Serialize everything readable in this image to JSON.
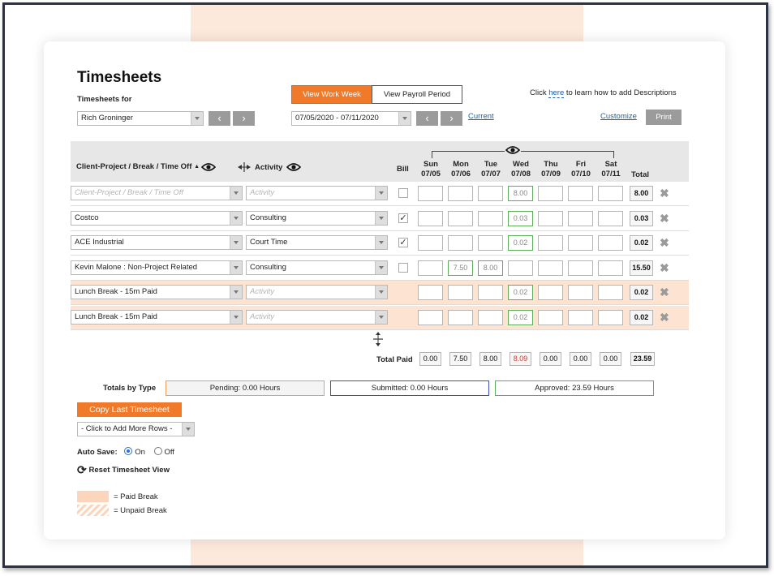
{
  "page_title": "Timesheets",
  "timesheets_for_label": "Timesheets for",
  "employee_select": "Rich Groninger",
  "view_toggle": {
    "work_week": "View Work Week",
    "payroll_period": "View Payroll Period"
  },
  "date_range": "07/05/2020 - 07/11/2020",
  "current_link": "Current",
  "help_text": {
    "prefix": "Click ",
    "link": "here",
    "suffix": " to learn how to add Descriptions"
  },
  "customize_link": "Customize",
  "print_button": "Print",
  "columns": {
    "client_project": "Client-Project / Break / Time Off",
    "activity": "Activity",
    "bill": "Bill",
    "days": [
      {
        "name": "Sun",
        "date": "07/05"
      },
      {
        "name": "Mon",
        "date": "07/06"
      },
      {
        "name": "Tue",
        "date": "07/07"
      },
      {
        "name": "Wed",
        "date": "07/08"
      },
      {
        "name": "Thu",
        "date": "07/09"
      },
      {
        "name": "Fri",
        "date": "07/10"
      },
      {
        "name": "Sat",
        "date": "07/11"
      }
    ],
    "total": "Total"
  },
  "rows": [
    {
      "project": "Client-Project / Break / Time Off",
      "project_placeholder": true,
      "activity": "Activity",
      "activity_placeholder": true,
      "bill": "unchecked",
      "values": [
        "",
        "",
        "",
        "8.00",
        "",
        "",
        ""
      ],
      "total": "8.00",
      "paid_break": false
    },
    {
      "project": "Costco",
      "project_placeholder": false,
      "activity": "Consulting",
      "activity_placeholder": false,
      "bill": "checked",
      "values": [
        "",
        "",
        "",
        "0.03",
        "",
        "",
        ""
      ],
      "total": "0.03",
      "paid_break": false
    },
    {
      "project": "ACE Industrial",
      "project_placeholder": false,
      "activity": "Court Time",
      "activity_placeholder": false,
      "bill": "checked",
      "values": [
        "",
        "",
        "",
        "0.02",
        "",
        "",
        ""
      ],
      "total": "0.02",
      "paid_break": false
    },
    {
      "project": "Kevin Malone : Non-Project Related",
      "project_placeholder": false,
      "activity": "Consulting",
      "activity_placeholder": false,
      "bill": "unchecked",
      "values": [
        "",
        "7.50",
        "8.00",
        "",
        "",
        "",
        ""
      ],
      "total": "15.50",
      "paid_break": false
    },
    {
      "project": "Lunch Break - 15m Paid",
      "project_placeholder": false,
      "activity": "Activity",
      "activity_placeholder": true,
      "bill": "none",
      "values": [
        "",
        "",
        "",
        "0.02",
        "",
        "",
        ""
      ],
      "total": "0.02",
      "paid_break": true
    },
    {
      "project": "Lunch Break - 15m Paid",
      "project_placeholder": false,
      "activity": "Activity",
      "activity_placeholder": true,
      "bill": "none",
      "values": [
        "",
        "",
        "",
        "0.02",
        "",
        "",
        ""
      ],
      "total": "0.02",
      "paid_break": true
    }
  ],
  "total_paid": {
    "label": "Total Paid",
    "values": [
      "0.00",
      "7.50",
      "8.00",
      "8.09",
      "0.00",
      "0.00",
      "0.00"
    ],
    "total": "23.59",
    "highlight_color": "#d9342b"
  },
  "totals_by_type": {
    "label": "Totals by Type",
    "pending": "Pending: 0.00 Hours",
    "submitted": "Submitted: 0.00 Hours",
    "approved": "Approved: 23.59 Hours"
  },
  "copy_last_timesheet": "Copy Last Timesheet",
  "add_rows_select": "- Click to Add More Rows -",
  "auto_save": {
    "label": "Auto Save:",
    "on": "On",
    "off": "Off",
    "selected": "On"
  },
  "reset_view": "Reset Timesheet View",
  "legend": {
    "paid_break": "= Paid Break",
    "unpaid_break": "= Unpaid Break"
  },
  "colors": {
    "accent_orange": "#f07a2a",
    "paid_break_bg": "#fde3d2",
    "approved_green": "#5cae5c",
    "submitted_blue": "#3c4fc0",
    "pending_orange": "#e8a060",
    "link_blue": "#1f5fa8",
    "frame_navy": "#2a3445"
  },
  "icons": {
    "eye": "eye-icon",
    "sort": "sort-up-icon",
    "column_resize": "column-resize-icon",
    "row_resize": "row-resize-icon",
    "delete": "close-icon",
    "reset": "refresh-icon",
    "prev": "chevron-left-icon",
    "next": "chevron-right-icon"
  }
}
